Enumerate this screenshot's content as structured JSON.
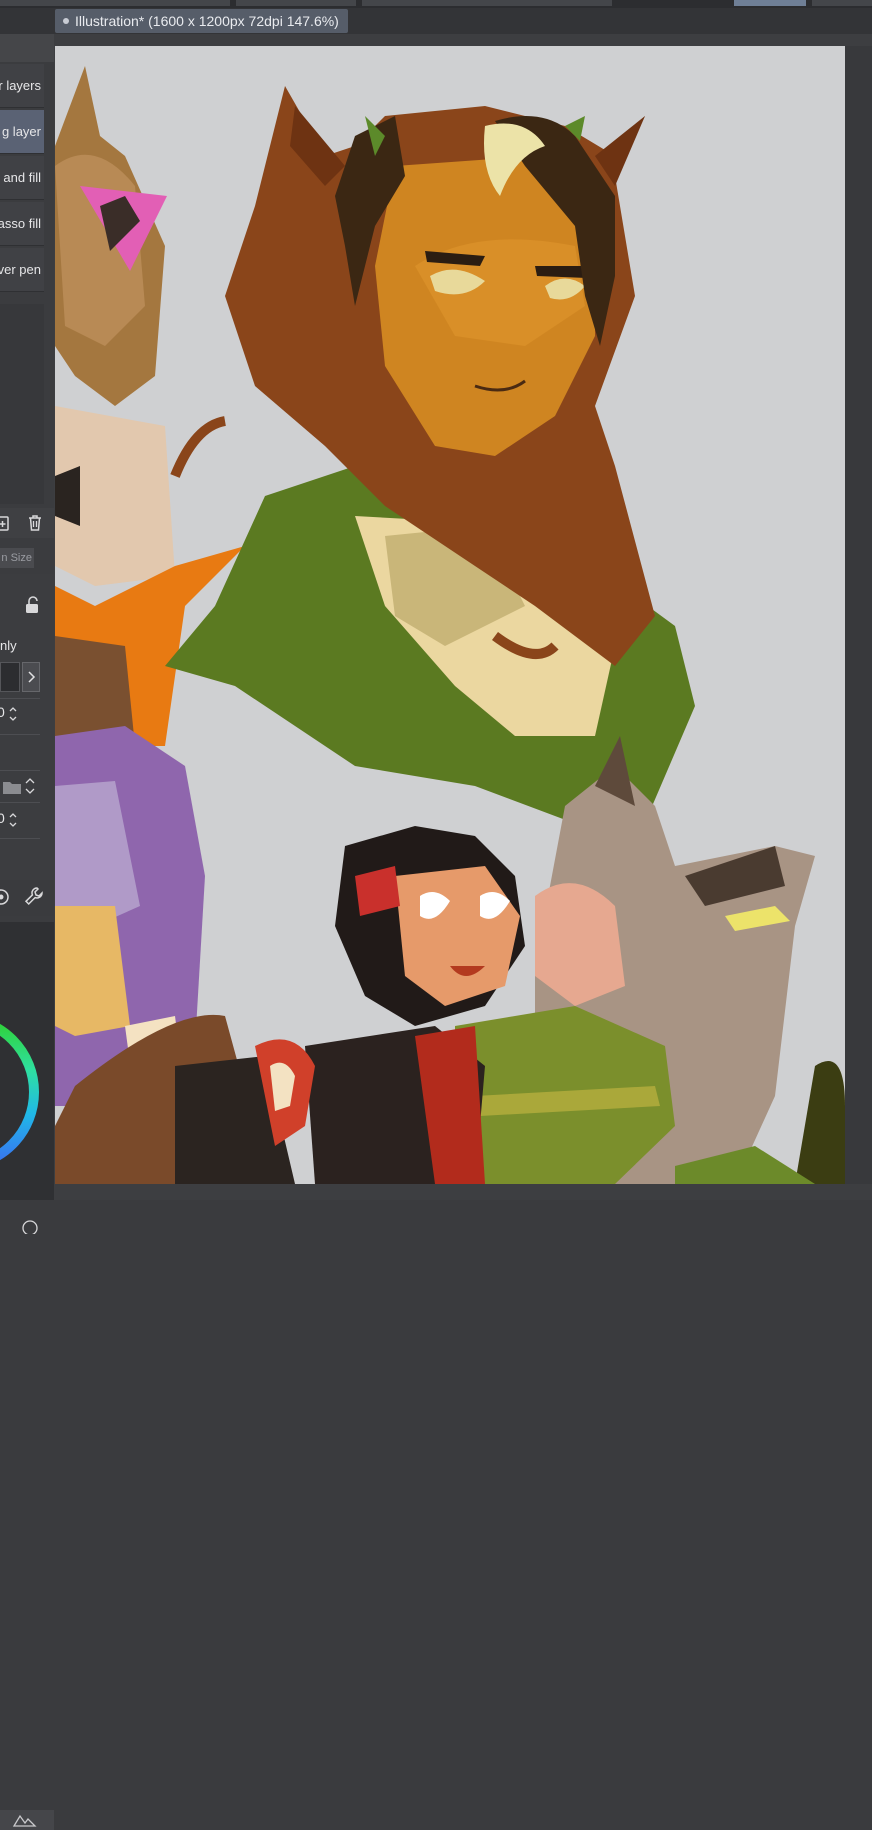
{
  "document_tab": {
    "title": "Illustration* (1600 x 1200px 72dpi 147.6%)"
  },
  "sub_tool_panel": {
    "items": [
      {
        "label": "r layers",
        "selected": false
      },
      {
        "label": "g layer",
        "selected": true
      },
      {
        "label": "and fill",
        "selected": false
      },
      {
        "label": "asso fill",
        "selected": false
      },
      {
        "label": "ver pen",
        "selected": false
      }
    ],
    "tab_label": "n Size"
  },
  "tool_property": {
    "option_label": "nly",
    "value_1": "0",
    "value_2": "0"
  },
  "icons": {
    "new_layer": "new-layer-icon",
    "delete": "trash-icon",
    "lock": "lock-icon",
    "next": "chevron-right-icon",
    "folder": "folder-icon",
    "settings": "wrench-icon"
  },
  "colors": {
    "canvas_bg": "#cfd0d2",
    "panel_bg": "#3b3c3f",
    "selected_item": "#5a6274",
    "tab_bg": "#565d69"
  }
}
